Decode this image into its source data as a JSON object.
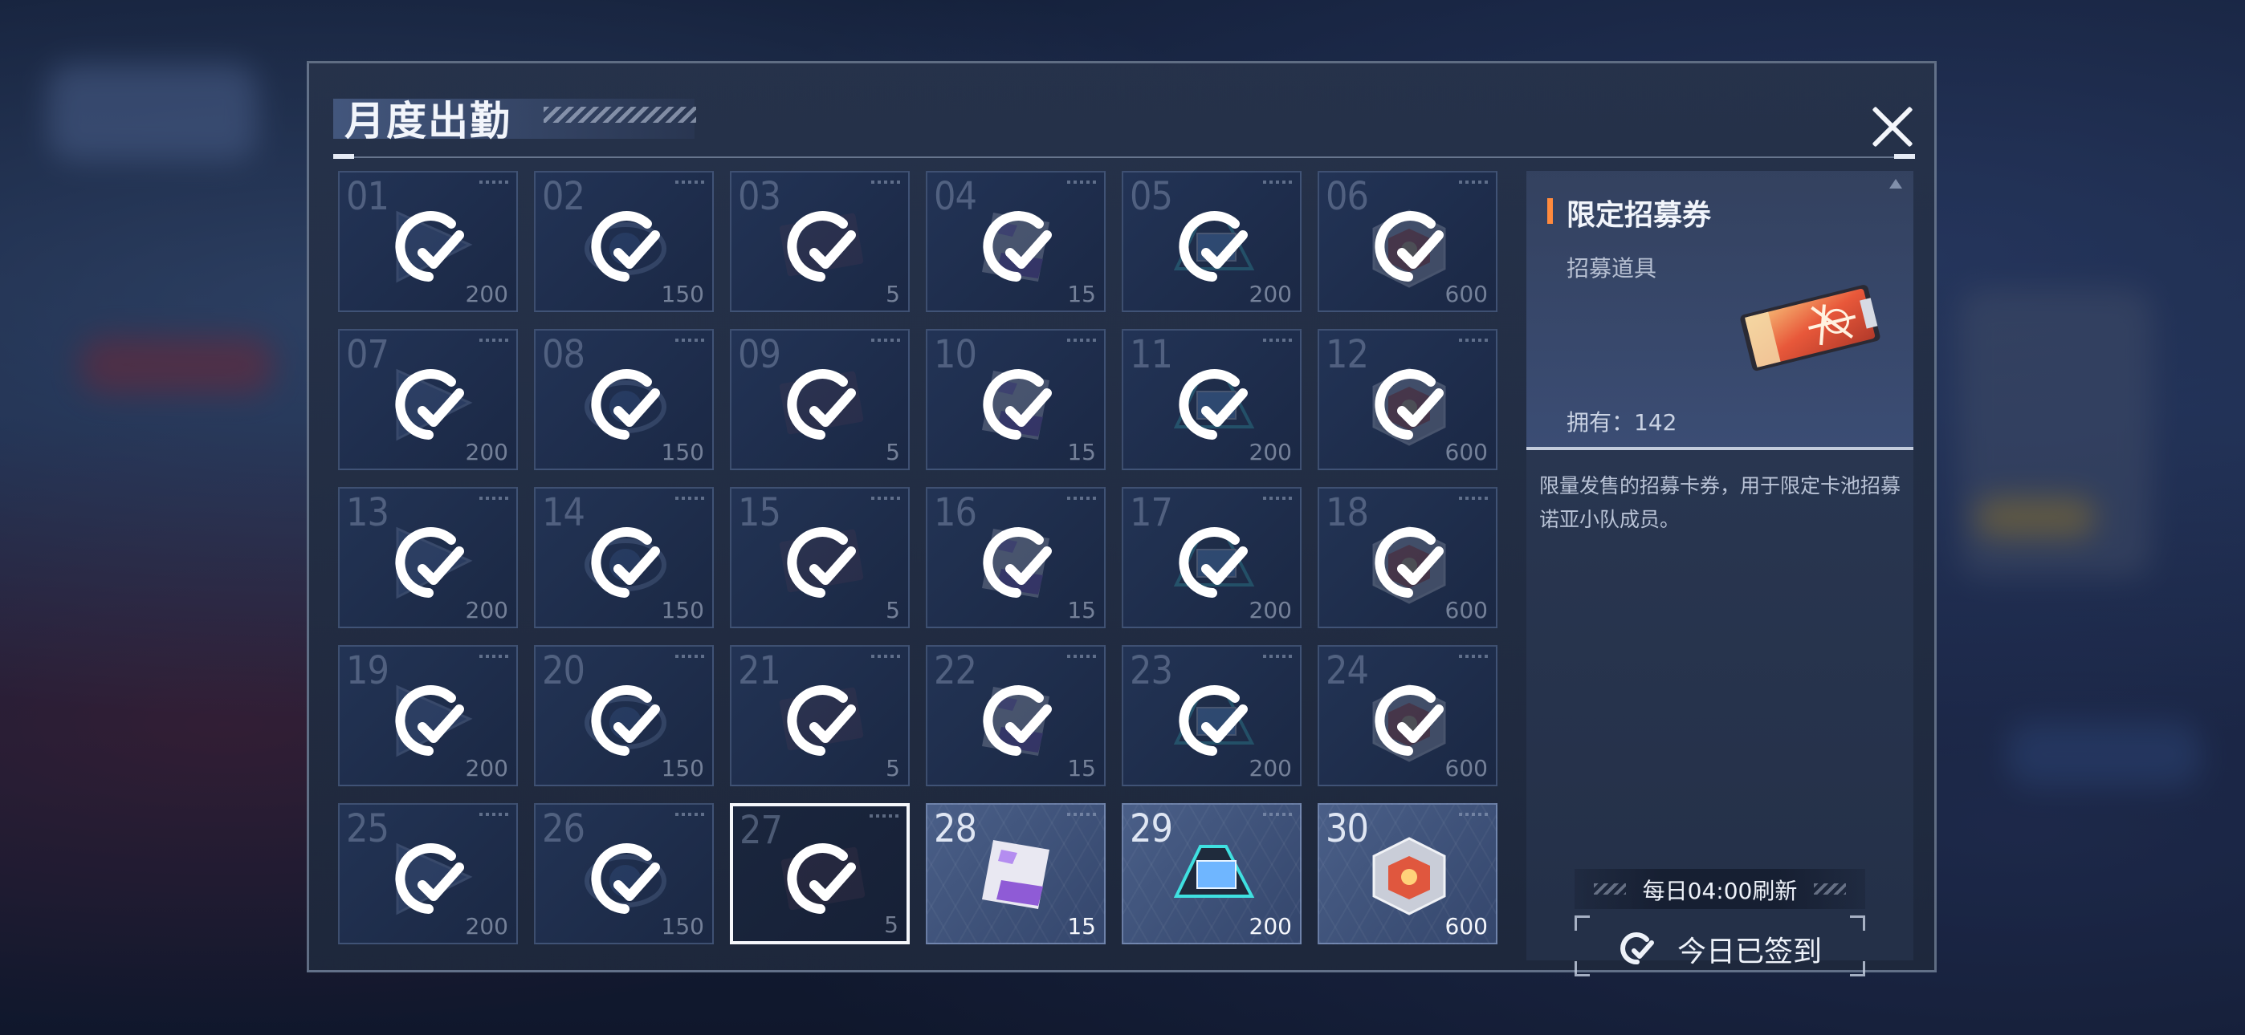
{
  "dialog": {
    "title": "月度出勤",
    "close_icon": "close-icon"
  },
  "days": [
    {
      "day": "01",
      "qty": "200",
      "item": "triangle-token",
      "status": "claimed"
    },
    {
      "day": "02",
      "qty": "150",
      "item": "ring-orb",
      "status": "claimed"
    },
    {
      "day": "03",
      "qty": "5",
      "item": "ticket-card",
      "status": "claimed"
    },
    {
      "day": "04",
      "qty": "15",
      "item": "purple-chip",
      "status": "claimed"
    },
    {
      "day": "05",
      "qty": "200",
      "item": "data-pad",
      "status": "claimed"
    },
    {
      "day": "06",
      "qty": "600",
      "item": "cube-box",
      "status": "claimed"
    },
    {
      "day": "07",
      "qty": "200",
      "item": "triangle-token",
      "status": "claimed"
    },
    {
      "day": "08",
      "qty": "150",
      "item": "ring-orb",
      "status": "claimed"
    },
    {
      "day": "09",
      "qty": "5",
      "item": "ticket-card",
      "status": "claimed"
    },
    {
      "day": "10",
      "qty": "15",
      "item": "purple-chip",
      "status": "claimed"
    },
    {
      "day": "11",
      "qty": "200",
      "item": "data-pad",
      "status": "claimed"
    },
    {
      "day": "12",
      "qty": "600",
      "item": "cube-box",
      "status": "claimed"
    },
    {
      "day": "13",
      "qty": "200",
      "item": "triangle-token",
      "status": "claimed"
    },
    {
      "day": "14",
      "qty": "150",
      "item": "ring-orb",
      "status": "claimed"
    },
    {
      "day": "15",
      "qty": "5",
      "item": "ticket-card",
      "status": "claimed"
    },
    {
      "day": "16",
      "qty": "15",
      "item": "purple-chip",
      "status": "claimed"
    },
    {
      "day": "17",
      "qty": "200",
      "item": "data-pad",
      "status": "claimed"
    },
    {
      "day": "18",
      "qty": "600",
      "item": "cube-box",
      "status": "claimed"
    },
    {
      "day": "19",
      "qty": "200",
      "item": "triangle-token",
      "status": "claimed"
    },
    {
      "day": "20",
      "qty": "150",
      "item": "ring-orb",
      "status": "claimed"
    },
    {
      "day": "21",
      "qty": "5",
      "item": "ticket-card",
      "status": "claimed"
    },
    {
      "day": "22",
      "qty": "15",
      "item": "purple-chip",
      "status": "claimed"
    },
    {
      "day": "23",
      "qty": "200",
      "item": "data-pad",
      "status": "claimed"
    },
    {
      "day": "24",
      "qty": "600",
      "item": "cube-box",
      "status": "claimed"
    },
    {
      "day": "25",
      "qty": "200",
      "item": "triangle-token",
      "status": "claimed"
    },
    {
      "day": "26",
      "qty": "150",
      "item": "ring-orb",
      "status": "claimed"
    },
    {
      "day": "27",
      "qty": "5",
      "item": "ticket-card",
      "status": "today-claimed"
    },
    {
      "day": "28",
      "qty": "15",
      "item": "purple-chip",
      "status": "unclaimed"
    },
    {
      "day": "29",
      "qty": "200",
      "item": "data-pad",
      "status": "unclaimed"
    },
    {
      "day": "30",
      "qty": "600",
      "item": "cube-box",
      "status": "unclaimed"
    }
  ],
  "detail": {
    "name": "限定招募券",
    "type": "招募道具",
    "owned": "拥有：142",
    "description": "限量发售的招募卡券，用于限定卡池招募诺亚小队成员。",
    "icon": "recruit-ticket-icon",
    "accent_color": "#ff8a3d"
  },
  "footer": {
    "refresh": "每日04:00刷新",
    "signed_label": "今日已签到",
    "signed_icon": "check-circle-icon"
  }
}
